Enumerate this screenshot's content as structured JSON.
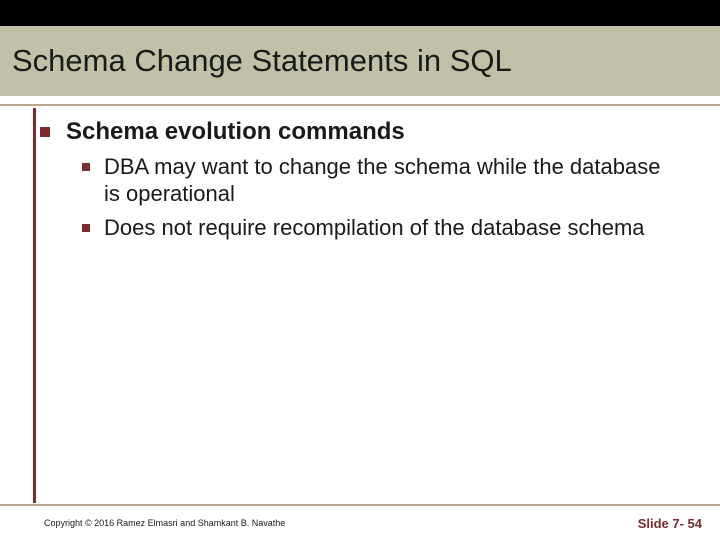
{
  "title": "Schema Change Statements in SQL",
  "bullets": {
    "level0": "Schema evolution commands",
    "level1": [
      "DBA may want to change the schema while the database is operational",
      "Does not require recompilation of the database schema"
    ]
  },
  "footer": {
    "copyright": "Copyright © 2016 Ramez Elmasri and Shamkant B. Navathe",
    "slide": "Slide 7- 54"
  }
}
